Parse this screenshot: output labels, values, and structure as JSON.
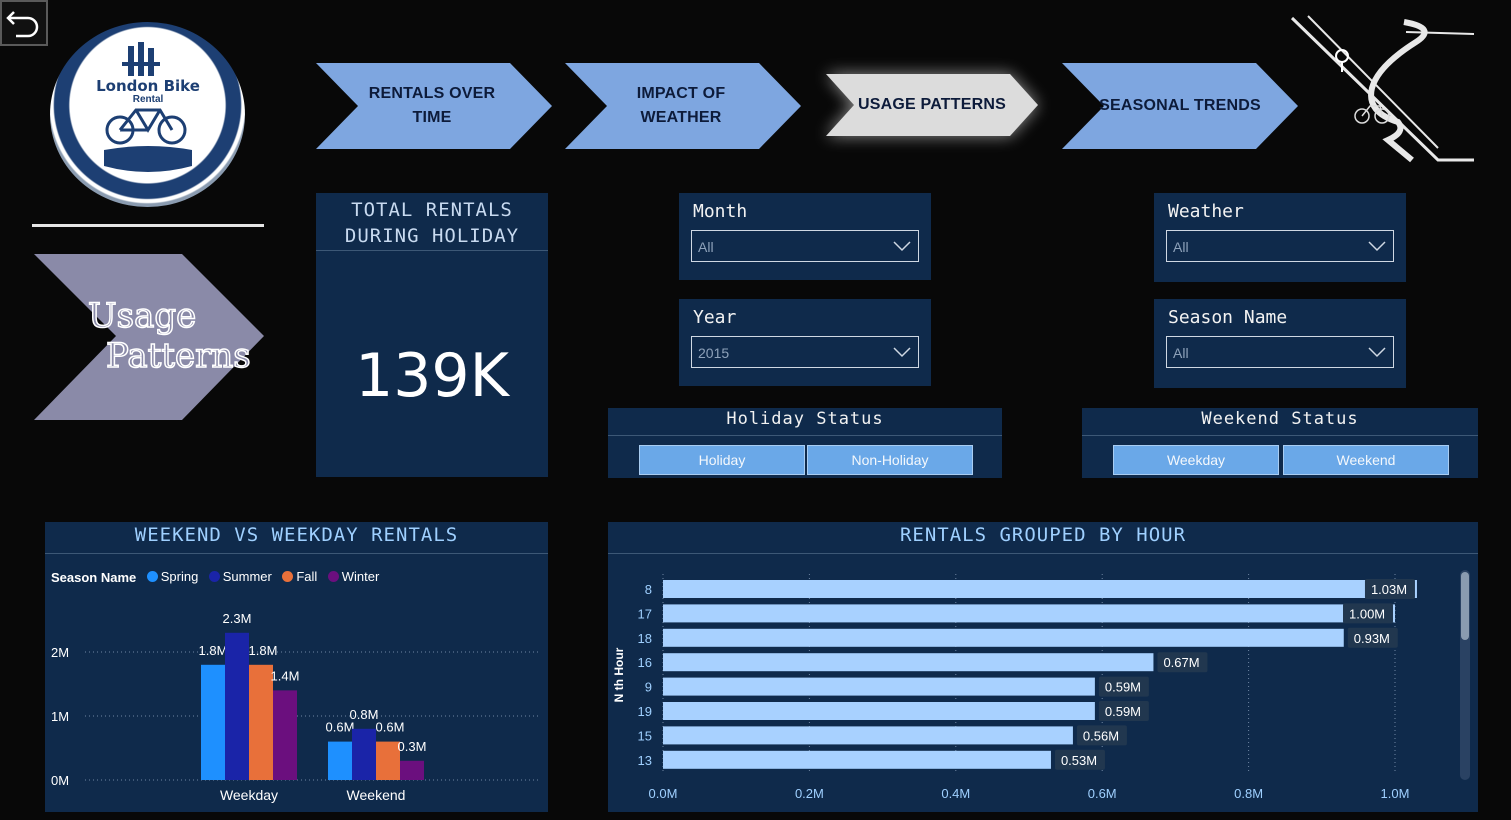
{
  "logo": {
    "title": "London Bike",
    "subtitle": "Rental"
  },
  "page_badge": {
    "line1": "Usage",
    "line2": "Patterns"
  },
  "nav": [
    {
      "line1": "RENTALS OVER",
      "line2": "TIME",
      "active": false
    },
    {
      "line1": "IMPACT OF",
      "line2": "WEATHER",
      "active": false
    },
    {
      "line1": "USAGE PATTERNS",
      "line2": "",
      "active": true
    },
    {
      "line1": "SEASONAL TRENDS",
      "line2": "",
      "active": false
    }
  ],
  "kpi": {
    "title_line1": "TOTAL RENTALS",
    "title_line2": "DURING HOLIDAY",
    "value": "139K"
  },
  "slicers": {
    "month": {
      "label": "Month",
      "value": "All"
    },
    "year": {
      "label": "Year",
      "value": "2015"
    },
    "weather": {
      "label": "Weather",
      "value": "All"
    },
    "season": {
      "label": "Season Name",
      "value": "All"
    }
  },
  "holiday": {
    "label": "Holiday Status",
    "options": [
      "Holiday",
      "Non-Holiday"
    ]
  },
  "weekend": {
    "label": "Weekend Status",
    "options": [
      "Weekday",
      "Weekend"
    ]
  },
  "colors": {
    "spring": "#1e90ff",
    "summer": "#1a24a8",
    "fall": "#e8703a",
    "winter": "#6b0f7e",
    "hour_bar": "#a8d1ff",
    "panel": "#0f2a4b"
  },
  "chart_data": [
    {
      "type": "bar",
      "title": "WEEKEND VS WEEKDAY RENTALS",
      "legend_title": "Season Name",
      "categories": [
        "Weekday",
        "Weekend"
      ],
      "series": [
        {
          "name": "Spring",
          "values": [
            1.8,
            0.6
          ],
          "labels": [
            "1.8M",
            "0.6M"
          ]
        },
        {
          "name": "Summer",
          "values": [
            2.3,
            0.8
          ],
          "labels": [
            "2.3M",
            "0.8M"
          ]
        },
        {
          "name": "Fall",
          "values": [
            1.8,
            0.6
          ],
          "labels": [
            "1.8M",
            "0.6M"
          ]
        },
        {
          "name": "Winter",
          "values": [
            1.4,
            0.3
          ],
          "labels": [
            "1.4M",
            "0.3M"
          ]
        }
      ],
      "y_ticks": [
        "0M",
        "1M",
        "2M"
      ],
      "ylim": [
        0,
        2.5
      ],
      "legend_position": "top-left",
      "grid": true
    },
    {
      "type": "bar",
      "orientation": "horizontal",
      "title": "RENTALS GROUPED BY HOUR",
      "ylabel": "N th Hour",
      "categories": [
        "8",
        "17",
        "18",
        "16",
        "9",
        "19",
        "15",
        "13"
      ],
      "values": [
        1.03,
        1.0,
        0.93,
        0.67,
        0.59,
        0.59,
        0.56,
        0.53
      ],
      "labels": [
        "1.03M",
        "1.00M",
        "0.93M",
        "0.67M",
        "0.59M",
        "0.59M",
        "0.56M",
        "0.53M"
      ],
      "x_ticks": [
        "0.0M",
        "0.2M",
        "0.4M",
        "0.6M",
        "0.8M",
        "1.0M"
      ],
      "xlim": [
        0,
        1.0
      ],
      "grid": true
    }
  ]
}
